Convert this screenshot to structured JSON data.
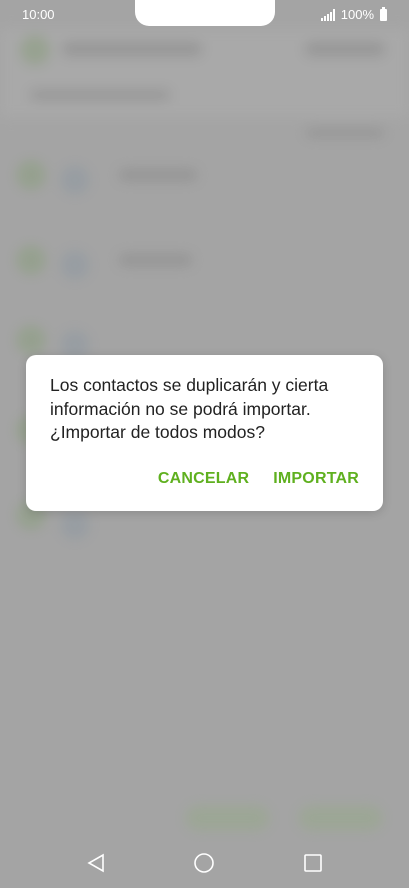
{
  "status_bar": {
    "time": "10:00",
    "battery": "100%"
  },
  "dialog": {
    "message": "Los contactos se duplicarán y cierta información no se podrá importar. ¿Importar de todos modos?",
    "cancel_label": "CANCELAR",
    "import_label": "IMPORTAR"
  },
  "colors": {
    "accent": "#5fb01f",
    "scrim": "#bcbcbc"
  },
  "icons": {
    "nav_back": "back-triangle-icon",
    "nav_home": "home-circle-icon",
    "nav_recent": "recent-square-icon"
  }
}
